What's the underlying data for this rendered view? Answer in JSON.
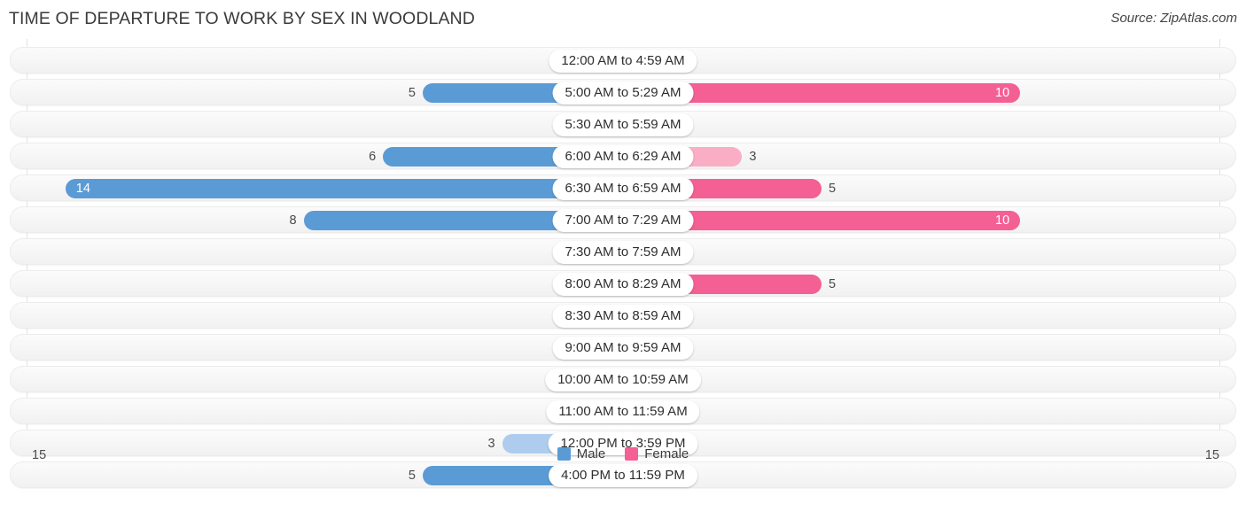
{
  "header": {
    "title": "TIME OF DEPARTURE TO WORK BY SEX IN WOODLAND",
    "source": "Source: ZipAtlas.com"
  },
  "legend": {
    "male_label": "Male",
    "female_label": "Female",
    "male_color": "#5b9bd5",
    "female_color": "#f45f94"
  },
  "axis": {
    "left_max_label": "15",
    "right_max_label": "15"
  },
  "colors": {
    "male_light": "#aecdee",
    "male_strong": "#5b9bd5",
    "female_light": "#f9aec6",
    "female_strong": "#f45f94",
    "track": "#f5f5f5",
    "gridline": "#e2e2e2"
  },
  "chart_data": {
    "type": "bar",
    "orientation": "horizontal-diverging",
    "title": "TIME OF DEPARTURE TO WORK BY SEX IN WOODLAND",
    "xlabel": "",
    "ylabel": "",
    "xlim": [
      15,
      15
    ],
    "grid": true,
    "legend_position": "bottom-center",
    "categories": [
      "12:00 AM to 4:59 AM",
      "5:00 AM to 5:29 AM",
      "5:30 AM to 5:59 AM",
      "6:00 AM to 6:29 AM",
      "6:30 AM to 6:59 AM",
      "7:00 AM to 7:29 AM",
      "7:30 AM to 7:59 AM",
      "8:00 AM to 8:29 AM",
      "8:30 AM to 8:59 AM",
      "9:00 AM to 9:59 AM",
      "10:00 AM to 10:59 AM",
      "11:00 AM to 11:59 AM",
      "12:00 PM to 3:59 PM",
      "4:00 PM to 11:59 PM"
    ],
    "series": [
      {
        "name": "Male",
        "values": [
          0,
          5,
          0,
          6,
          14,
          8,
          1,
          0,
          0,
          0,
          0,
          0,
          3,
          5
        ]
      },
      {
        "name": "Female",
        "values": [
          1,
          10,
          0,
          3,
          5,
          10,
          1,
          5,
          0,
          0,
          0,
          0,
          0,
          0
        ]
      }
    ]
  }
}
